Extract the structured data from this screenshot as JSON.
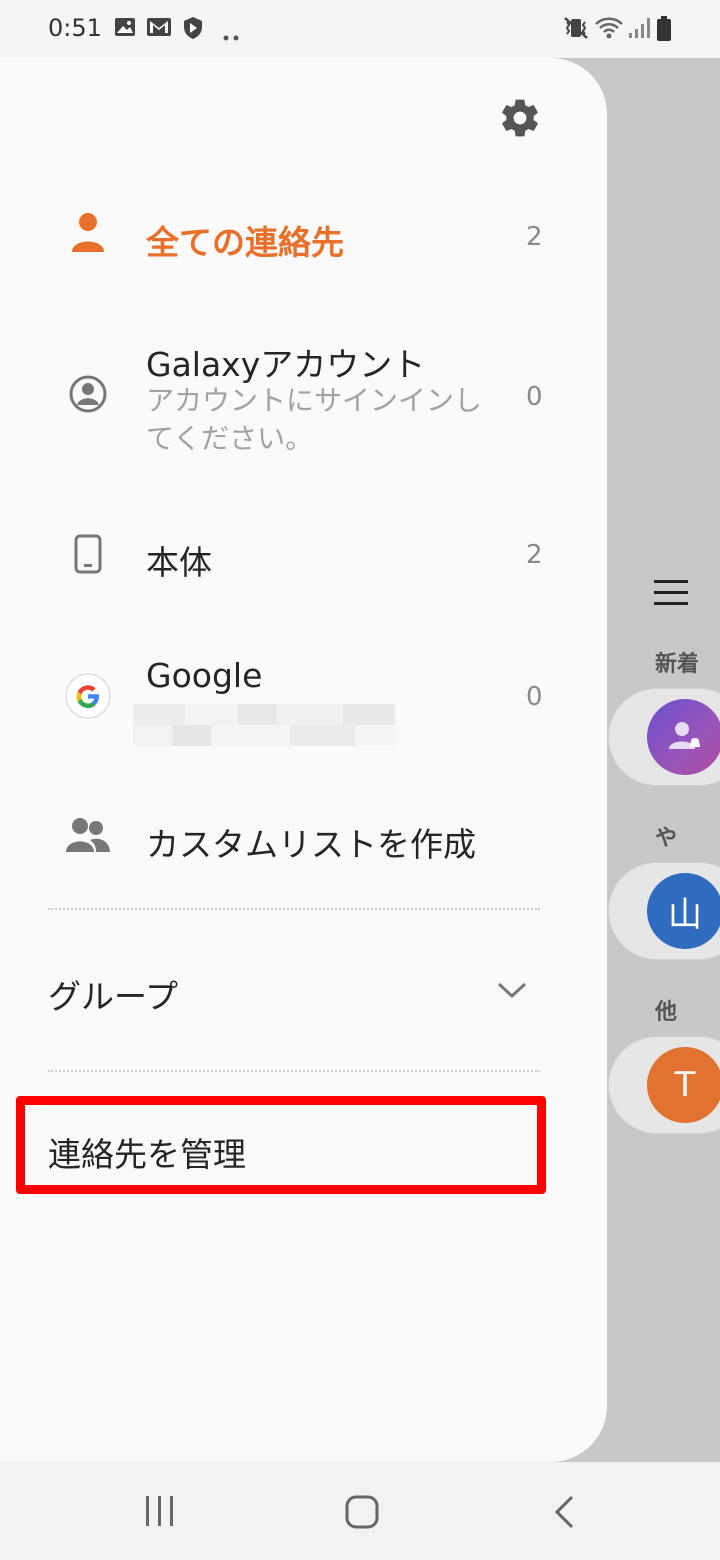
{
  "status_bar": {
    "time": "0:51",
    "left_icons": [
      "image-icon",
      "gmail-icon",
      "shield-icon",
      "more-dots-icon"
    ],
    "right_icons": [
      "vibrate-icon",
      "wifi-icon",
      "signal-icon",
      "battery-icon"
    ]
  },
  "drawer": {
    "settings_icon": "gear-icon",
    "items": [
      {
        "icon": "person-icon",
        "title": "全ての連絡先",
        "count": "2",
        "active": true
      },
      {
        "icon": "account-circle-icon",
        "title": "Galaxyアカウント",
        "subtitle_line1": "アカウントにサインインし",
        "subtitle_line2": "てください。",
        "count": "0"
      },
      {
        "icon": "phone-device-icon",
        "title": "本体",
        "count": "2"
      },
      {
        "icon": "google-icon",
        "title": "Google",
        "count": "0"
      },
      {
        "icon": "group-icon",
        "title": "カスタムリストを作成"
      }
    ],
    "group_label": "グループ",
    "manage_label": "連絡先を管理"
  },
  "background": {
    "sections": [
      "新着",
      "や",
      "他"
    ],
    "avatars": [
      {
        "letter": "",
        "color": "#7a5cc4"
      },
      {
        "letter": "山",
        "color": "#2f6cc0"
      },
      {
        "letter": "T",
        "color": "#e2722f"
      }
    ]
  },
  "colors": {
    "accent": "#e8702a",
    "highlight_box": "#ff0000"
  },
  "nav_bar": {
    "buttons": [
      "recent-apps-icon",
      "home-icon",
      "back-icon"
    ]
  }
}
